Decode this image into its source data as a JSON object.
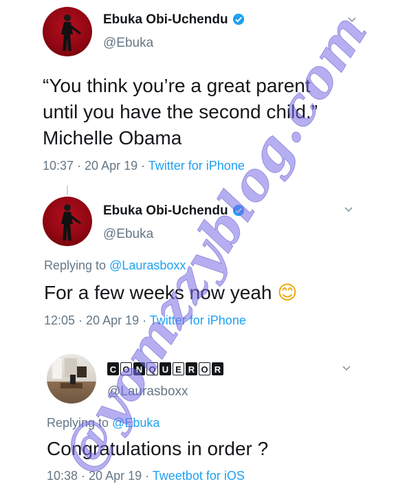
{
  "tweets": [
    {
      "name": "Ebuka Obi-Uchendu",
      "handle": "@Ebuka",
      "verified": true,
      "text_lines": [
        "“You think you’re a great parent",
        "until you have the second child.”",
        "Michelle Obama"
      ],
      "time": "10:37 · 20 Apr 19 · ",
      "source": "Twitter for iPhone"
    },
    {
      "name": "Ebuka Obi-Uchendu",
      "handle": "@Ebuka",
      "verified": true,
      "replying_label": "Replying to ",
      "replying_to": "@Laurasboxx",
      "text": "For a few weeks now yeah",
      "emoji": "😊",
      "time": "12:05 · 20 Apr 19 · ",
      "source": "Twitter for iPhone"
    },
    {
      "name_boxes": [
        "C",
        "O",
        "N",
        "Q",
        "U",
        "E",
        "R",
        "O",
        "R"
      ],
      "handle": "@Laurasboxx",
      "replying_label": "Replying to ",
      "replying_to": "@Ebuka",
      "text": "Congratulations in order ?",
      "time": "10:38 · 20 Apr 19 · ",
      "source": "Tweetbot for iOS"
    }
  ],
  "watermark": "@yomzzyblog.com",
  "colors": {
    "link": "#1da1f2",
    "secondary": "#657786",
    "watermark": "#7a6ee6"
  }
}
